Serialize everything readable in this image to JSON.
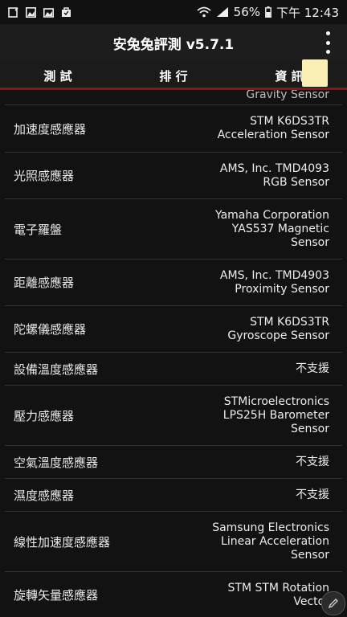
{
  "status_bar": {
    "battery": "56%",
    "time": "下午 12:43"
  },
  "app": {
    "title": "安兔兔評測 v5.7.1",
    "tabs": [
      {
        "label": "測 試"
      },
      {
        "label": "排 行"
      },
      {
        "label": "資 訊"
      }
    ]
  },
  "sensors": {
    "partial_value": "Gravity Sensor",
    "rows": [
      {
        "label": "加速度感應器",
        "value": [
          "STM K6DS3TR",
          "Acceleration Sensor"
        ]
      },
      {
        "label": "光照感應器",
        "value": [
          "AMS, Inc. TMD4093",
          "RGB Sensor"
        ]
      },
      {
        "label": "電子羅盤",
        "value": [
          "Yamaha Corporation",
          "YAS537 Magnetic",
          "Sensor"
        ]
      },
      {
        "label": "距離感應器",
        "value": [
          "AMS, Inc. TMD4903",
          "Proximity Sensor"
        ]
      },
      {
        "label": "陀螺儀感應器",
        "value": [
          "STM K6DS3TR",
          "Gyroscope Sensor"
        ]
      },
      {
        "label": "設備溫度感應器",
        "value": [
          "不支援"
        ]
      },
      {
        "label": "壓力感應器",
        "value": [
          "STMicroelectronics",
          "LPS25H Barometer",
          "Sensor"
        ]
      },
      {
        "label": "空氣溫度感應器",
        "value": [
          "不支援"
        ]
      },
      {
        "label": "濕度感應器",
        "value": [
          "不支援"
        ]
      },
      {
        "label": "線性加速度感應器",
        "value": [
          "Samsung Electronics",
          "Linear Acceleration",
          "Sensor"
        ]
      },
      {
        "label": "旋轉矢量感應器",
        "value": [
          "STM STM Rotation",
          "Vector"
        ]
      }
    ]
  }
}
